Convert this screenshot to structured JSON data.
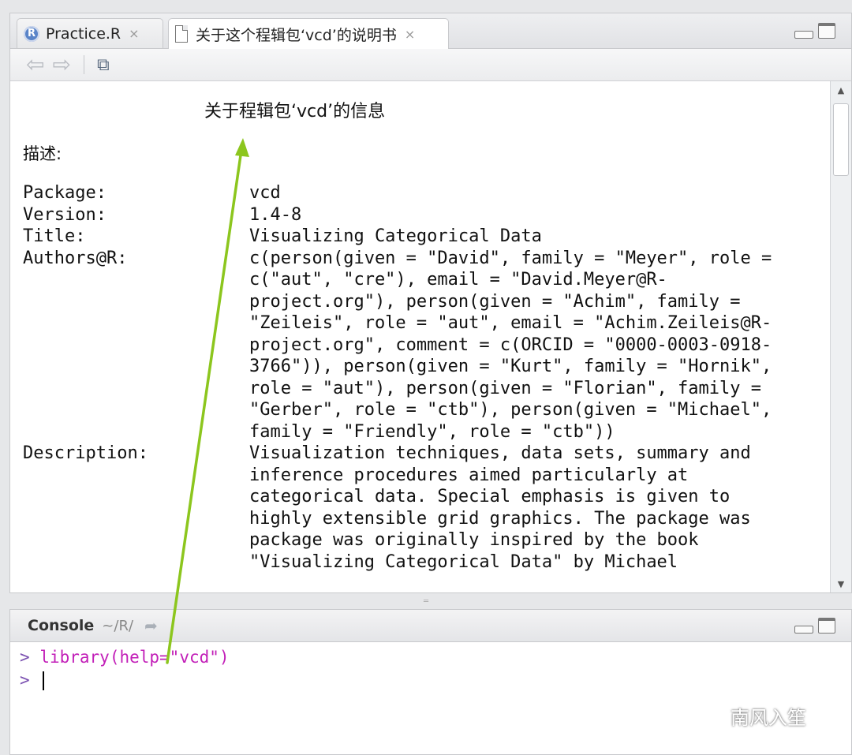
{
  "editor": {
    "tabs": [
      {
        "label": "Practice.R",
        "icon": "r-file-icon",
        "close": "×"
      },
      {
        "label": "关于这个程辑包‘vcd’的说明书",
        "icon": "document-icon",
        "close": "×"
      }
    ],
    "toolbar": {
      "back": "⇦",
      "forward": "⇨",
      "show_icon": "⧉"
    }
  },
  "help": {
    "title": "关于程辑包‘vcd’的信息",
    "description_label": "描述:",
    "fields": [
      {
        "key": "Package:",
        "value": "vcd"
      },
      {
        "key": "Version:",
        "value": "1.4-8"
      },
      {
        "key": "Title:",
        "value": "Visualizing Categorical Data"
      },
      {
        "key": "Authors@R:",
        "value": "c(person(given = \"David\", family = \"Meyer\", role = c(\"aut\", \"cre\"), email = \"David.Meyer@R-project.org\"), person(given = \"Achim\", family = \"Zeileis\", role = \"aut\", email = \"Achim.Zeileis@R-project.org\", comment = c(ORCID = \"0000-0003-0918-3766\")), person(given = \"Kurt\", family = \"Hornik\", role = \"aut\"), person(given = \"Florian\", family = \"Gerber\", role = \"ctb\"), person(given = \"Michael\", family = \"Friendly\", role = \"ctb\"))"
      },
      {
        "key": "Description:",
        "value": "Visualization techniques, data sets, summary and inference procedures aimed particularly at categorical data. Special emphasis is given to highly extensible grid graphics. The package was package was originally inspired by the book \"Visualizing Categorical Data\" by Michael"
      }
    ]
  },
  "console": {
    "title": "Console",
    "path": "~/R/",
    "lines": [
      {
        "prompt": ">",
        "text": "library(help=\"vcd\")"
      },
      {
        "prompt": ">",
        "text": ""
      }
    ]
  },
  "watermark": {
    "text": "南风入笙"
  },
  "colors": {
    "annotation_arrow": "#8cc61e",
    "console_command": "#c21fb8"
  }
}
